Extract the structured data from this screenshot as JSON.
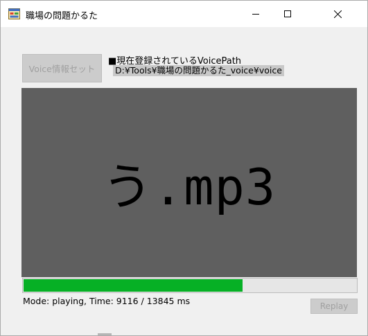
{
  "window": {
    "title": "職場の問題かるた",
    "app_icon": "windows-form-icon",
    "controls": [
      "minimize-icon",
      "maximize-icon",
      "close-icon"
    ]
  },
  "voice": {
    "set_button_label": "Voice情報セット",
    "path_heading": "■現在登録されているVoicePath",
    "path_value": "D:¥Tools¥職場の問題かるた_voice¥voice"
  },
  "player": {
    "current_file": "う.mp3",
    "progress_fraction": 0.6585,
    "status_text": "Mode: playing, Time: 9116 / 13845 ms",
    "replay_label": "Replay"
  },
  "colors": {
    "display_background": "#5f5f5f",
    "progress_fill": "#06b025",
    "window_background": "#f0f0f0"
  }
}
